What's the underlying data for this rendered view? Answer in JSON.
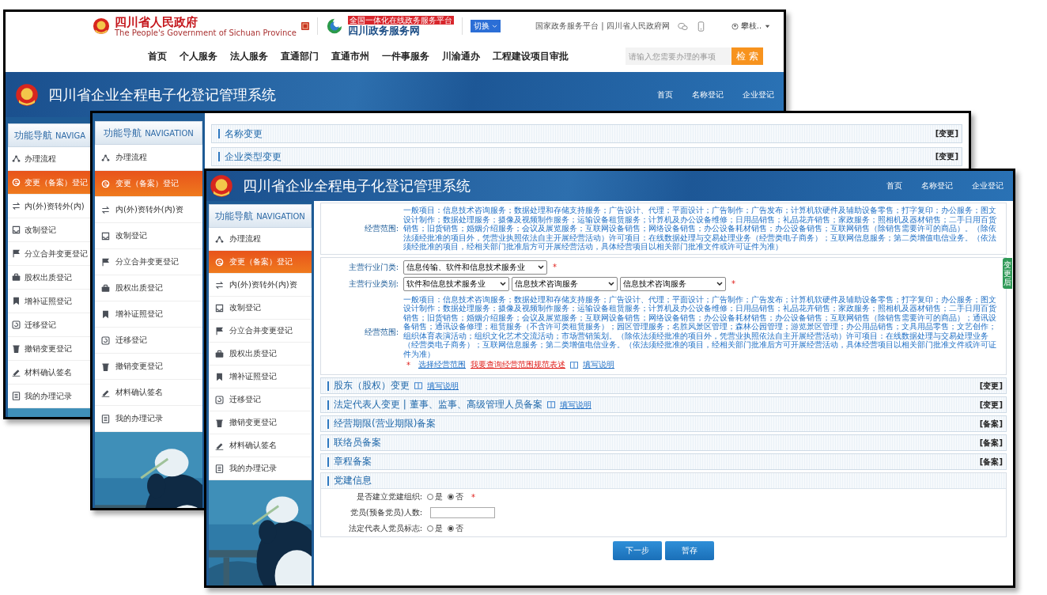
{
  "windows": [
    {
      "portal_header": {
        "gov_name": "四川省人民政府",
        "gov_name_en": "The People's Government of Sichuan Province",
        "platform_tag": "全国一体化在线政务服务平台",
        "platform_name": "四川政务服务网",
        "switch": "切换",
        "top_links": "国家政务服务平台 | 四川省人民政府网",
        "user": "攀枝..",
        "nav": [
          "首页",
          "个人服务",
          "法人服务",
          "直通部门",
          "直通市州",
          "一件事服务",
          "川渝通办",
          "工程建设项目审批"
        ],
        "search_placeholder": "请输入您需要办理的事项",
        "search_button": "检 索"
      },
      "banner": {
        "title": "四川省企业全程电子化登记管理系统",
        "nav": [
          "首页",
          "名称登记",
          "企业登记"
        ]
      },
      "sidebar": {
        "title": "功能导航",
        "title_en": "NAVIGA",
        "items": [
          {
            "label": "办理流程",
            "selected": false
          },
          {
            "label": "变更（备案）登记",
            "selected": true
          },
          {
            "label": "内(外)资转外(内)",
            "selected": false
          },
          {
            "label": "改制登记",
            "selected": false
          },
          {
            "label": "分立合并变更登记",
            "selected": false
          },
          {
            "label": "股权出质登记",
            "selected": false
          },
          {
            "label": "增补证照登记",
            "selected": false
          },
          {
            "label": "迁移登记",
            "selected": false
          },
          {
            "label": "撤销变更登记",
            "selected": false
          },
          {
            "label": "材料确认签名",
            "selected": false
          },
          {
            "label": "我的办理记录",
            "selected": false
          }
        ]
      }
    },
    {
      "sidebar": {
        "title": "功能导航",
        "title_en": "NAVIGATION",
        "items": [
          {
            "label": "办理流程",
            "selected": false
          },
          {
            "label": "变更（备案）登记",
            "selected": true
          },
          {
            "label": "内(外)资转外(内)资",
            "selected": false
          },
          {
            "label": "改制登记",
            "selected": false
          },
          {
            "label": "分立合并变更登记",
            "selected": false
          },
          {
            "label": "股权出质登记",
            "selected": false
          },
          {
            "label": "增补证照登记",
            "selected": false
          },
          {
            "label": "迁移登记",
            "selected": false
          },
          {
            "label": "撤销变更登记",
            "selected": false
          },
          {
            "label": "材料确认签名",
            "selected": false
          },
          {
            "label": "我的办理记录",
            "selected": false
          }
        ]
      },
      "panels": [
        {
          "title": "名称变更",
          "action": "[变更]"
        },
        {
          "title": "企业类型变更",
          "action": "[变更]"
        }
      ]
    },
    {
      "banner": {
        "title": "四川省企业全程电子化登记管理系统",
        "nav": [
          "首页",
          "名称登记",
          "企业登记"
        ]
      },
      "sidebar": {
        "title": "功能导航",
        "title_en": "NAVIGATION",
        "items": [
          {
            "label": "办理流程",
            "selected": false
          },
          {
            "label": "变更（备案）登记",
            "selected": true
          },
          {
            "label": "内(外)资转外(内)资",
            "selected": false
          },
          {
            "label": "改制登记",
            "selected": false
          },
          {
            "label": "分立合并变更登记",
            "selected": false
          },
          {
            "label": "股权出质登记",
            "selected": false
          },
          {
            "label": "增补证照登记",
            "selected": false
          },
          {
            "label": "迁移登记",
            "selected": false
          },
          {
            "label": "撤销变更登记",
            "selected": false
          },
          {
            "label": "材料确认签名",
            "selected": false
          },
          {
            "label": "我的办理记录",
            "selected": false
          }
        ]
      },
      "scope_before": {
        "label": "经营范围:",
        "text": "一般项目：信息技术咨询服务；数据处理和存储支持服务；广告设计、代理；平面设计；广告制作；广告发布；计算机软硬件及辅助设备零售；打字复印；办公服务；图文设计制作；数据处理服务；摄像及视频制作服务；运输设备租赁服务；计算机及办公设备维修；日用品销售；礼品花卉销售；家政服务；照相机及器材销售；二手日用百货销售；旧货销售；婚姻介绍服务；会议及展览服务；互联网设备销售；网络设备销售；办公设备耗材销售；办公设备销售；互联网销售（除销售需要许可的商品）。（除依法须经批准的项目外，凭营业执照依法自主开展经营活动）许可项目：在线数据处理与交易处理业务（经营类电子商务）；互联网信息服务；第二类增值电信业务。（依法须经批准的项目，经相关部门批准后方可开展经营活动，具体经营项目以相关部门批准文件或许可证件为准）"
      },
      "scope_after": {
        "tab": "变更后",
        "industry_category": {
          "label": "主营行业门类:",
          "value": "信息传输、软件和信息技术服务业",
          "required_mark": "*"
        },
        "industry_class": {
          "label": "主营行业类别:",
          "values": [
            "软件和信息技术服务业",
            "信息技术咨询服务",
            "信息技术咨询服务"
          ],
          "required_mark": "*"
        },
        "scope": {
          "label": "经营范围:",
          "text": "一般项目：信息技术咨询服务；数据处理和存储支持服务；广告设计、代理；平面设计；广告制作；广告发布；计算机软硬件及辅助设备零售；打字复印；办公服务；图文设计制作；数据处理服务；摄像及视频制作服务；运输设备租赁服务；计算机及办公设备维修；日用品销售；礼品花卉销售；家政服务；照相机及器材销售；二手日用百货销售；旧货销售；婚姻介绍服务；会议及展览服务；互联网设备销售；网络设备销售；办公设备耗材销售；办公设备销售；互联网销售（除销售需要许可的商品）；通讯设备销售；通讯设备修理；租赁服务（不含许可类租赁服务）；园区管理服务；名胜风景区管理；森林公园管理；游览景区管理；办公用品销售；文具用品零售；文艺创作；组织体育表演活动；组织文化艺术交流活动；市场营销策划。（除依法须经批准的项目外，凭营业执照依法自主开展经营活动）许可项目：在线数据处理与交易处理业务（经营类电子商务）；互联网信息服务；第二类增值电信业务。（依法须经批准的项目，经相关部门批准后方可开展经营活动，具体经营项目以相关部门批准文件或许可证件为准）",
          "required_mark": "*",
          "select_link": "选择经营范围",
          "query_link": "我要查询经营范围规范表述",
          "help_link": "填写说明"
        }
      },
      "panels": [
        {
          "title": "股东（股权）变更",
          "link": "填写说明",
          "action": "[变更]"
        },
        {
          "title": "法定代表人变更 | 董事、监事、高级管理人员备案",
          "link": "填写说明",
          "action": "[变更]"
        },
        {
          "title": "经营期限(营业期限)备案",
          "action": "[备案]"
        },
        {
          "title": "联络员备案",
          "action": "[备案]"
        },
        {
          "title": "章程备案",
          "action": "[备案]"
        }
      ],
      "party": {
        "title": "党建信息",
        "rows": [
          {
            "kind": "radio",
            "label": "是否建立党建组织:",
            "options": [
              {
                "label": "是",
                "selected": false
              },
              {
                "label": "否",
                "selected": true
              }
            ],
            "required_mark": "*"
          },
          {
            "kind": "input",
            "label": "党员(预备党员)人数:"
          },
          {
            "kind": "radio",
            "label": "法定代表人党员标志:",
            "options": [
              {
                "label": "是",
                "selected": false
              },
              {
                "label": "否",
                "selected": true
              }
            ]
          }
        ]
      },
      "buttons": [
        "下一步",
        "暂存"
      ]
    }
  ]
}
